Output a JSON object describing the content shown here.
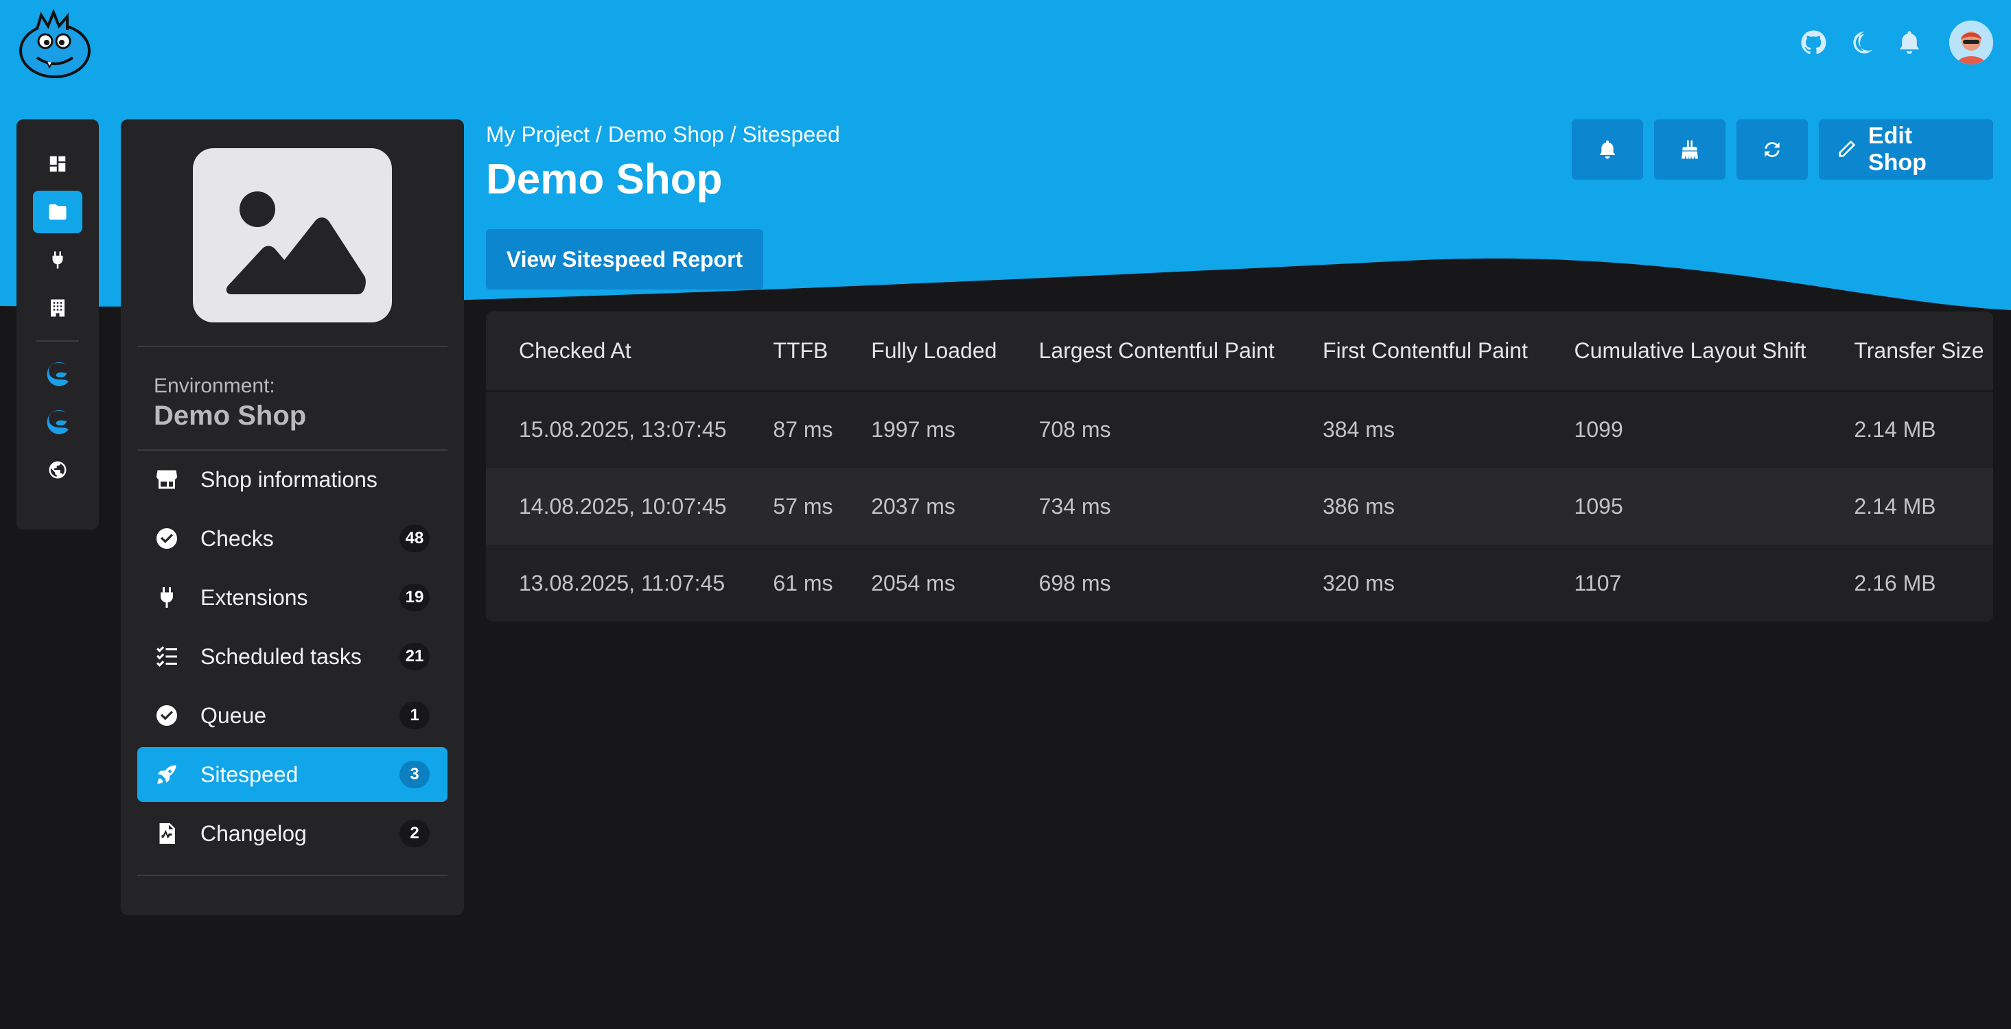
{
  "header": {
    "breadcrumb": [
      "My Project",
      "Demo Shop",
      "Sitespeed"
    ],
    "separator": " / ",
    "title": "Demo Shop",
    "report_button": "View Sitespeed Report",
    "edit_button": "Edit Shop"
  },
  "sidebar": {
    "environment_label": "Environment:",
    "environment_name": "Demo Shop",
    "items": [
      {
        "label": "Shop informations",
        "icon": "store-icon",
        "badge": null
      },
      {
        "label": "Checks",
        "icon": "check-circle-icon",
        "badge": "48"
      },
      {
        "label": "Extensions",
        "icon": "plug-icon",
        "badge": "19"
      },
      {
        "label": "Scheduled tasks",
        "icon": "task-list-icon",
        "badge": "21"
      },
      {
        "label": "Queue",
        "icon": "check-circle-icon",
        "badge": "1"
      },
      {
        "label": "Sitespeed",
        "icon": "rocket-icon",
        "badge": "3",
        "active": true
      },
      {
        "label": "Changelog",
        "icon": "file-chart-icon",
        "badge": "2"
      }
    ]
  },
  "table": {
    "columns": [
      "Checked At",
      "TTFB",
      "Fully Loaded",
      "Largest Contentful Paint",
      "First Contentful Paint",
      "Cumulative Layout Shift",
      "Transfer Size"
    ],
    "rows": [
      [
        "15.08.2025, 13:07:45",
        "87 ms",
        "1997 ms",
        "708 ms",
        "384 ms",
        "1099",
        "2.14 MB"
      ],
      [
        "14.08.2025, 10:07:45",
        "57 ms",
        "2037 ms",
        "734 ms",
        "386 ms",
        "1095",
        "2.14 MB"
      ],
      [
        "13.08.2025, 11:07:45",
        "61 ms",
        "2054 ms",
        "698 ms",
        "320 ms",
        "1107",
        "2.16 MB"
      ]
    ]
  },
  "colors": {
    "accent": "#11a5e9",
    "button": "#0b86cf",
    "background": "#17171a",
    "panel": "#242427"
  }
}
